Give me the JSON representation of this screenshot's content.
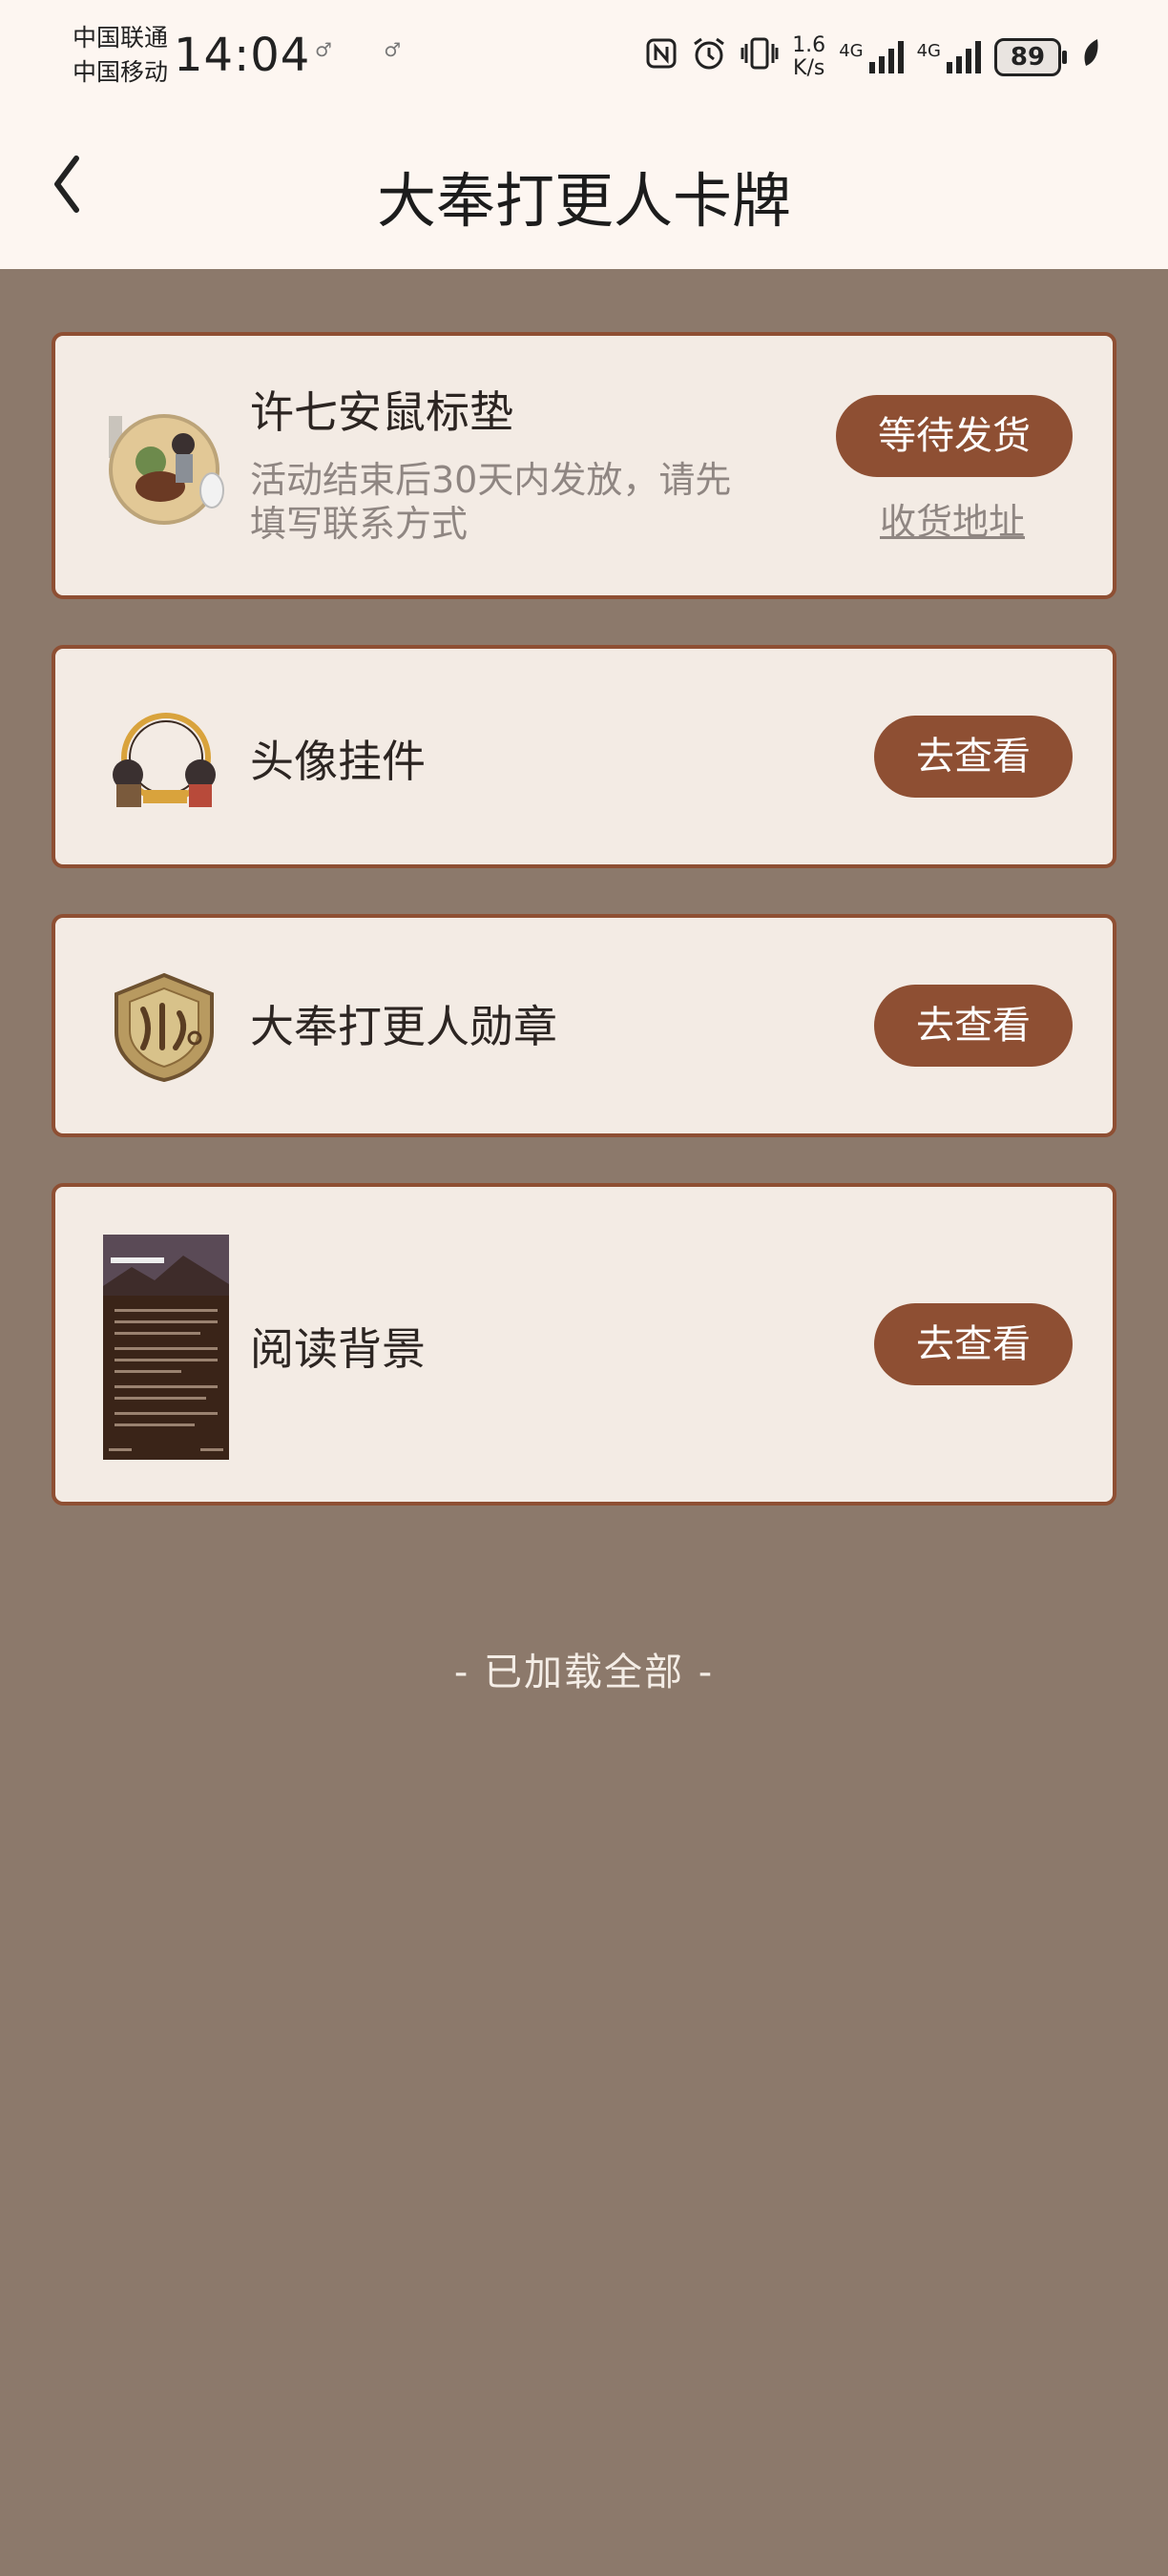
{
  "status_bar": {
    "carrier_1": "中国联通",
    "carrier_2": "中国移动",
    "time": "14:04",
    "net_speed_value": "1.6",
    "net_speed_unit": "K/s",
    "signal_1_label": "4G",
    "signal_2_label": "4G",
    "battery": "89"
  },
  "header": {
    "title": "大奉打更人卡牌"
  },
  "items": [
    {
      "title": "许七安鼠标垫",
      "desc": "活动结束后30天内发放，请先填写联系方式",
      "button": "等待发货",
      "link": "收货地址"
    },
    {
      "title": "头像挂件",
      "button": "去查看"
    },
    {
      "title": "大奉打更人勋章",
      "button": "去查看"
    },
    {
      "title": "阅读背景",
      "button": "去查看"
    }
  ],
  "footer": {
    "text": "- 已加载全部 -"
  },
  "colors": {
    "accent": "#8e4f33",
    "background": "#8c796b",
    "card": "#f3ebe4",
    "header": "#fdf6f1"
  }
}
